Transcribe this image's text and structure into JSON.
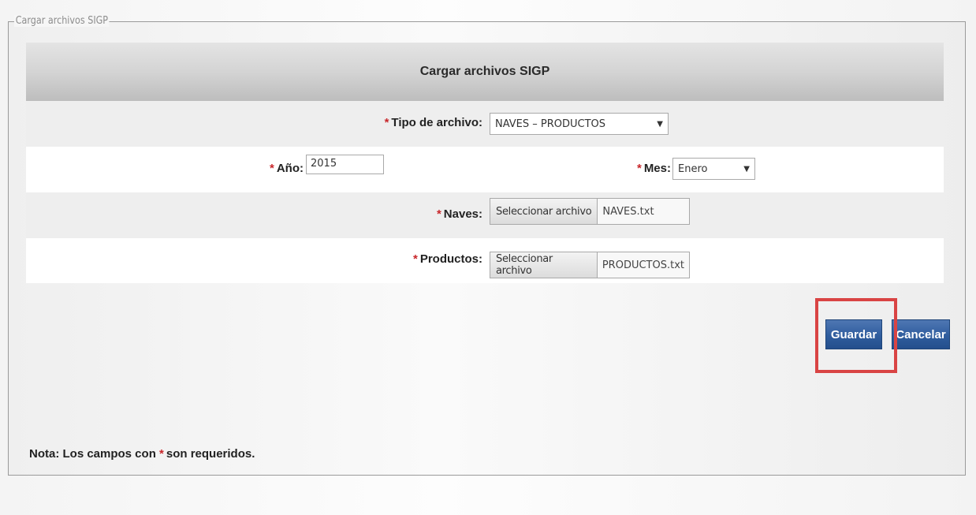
{
  "fieldset": {
    "legend": "Cargar archivos SIGP"
  },
  "form": {
    "header": "Cargar archivos SIGP",
    "required_mark": "*",
    "tipo_archivo": {
      "label": "Tipo de archivo:",
      "value": "NAVES – PRODUCTOS"
    },
    "anio": {
      "label": "Año:",
      "value": "2015"
    },
    "mes": {
      "label": "Mes:",
      "value": "Enero"
    },
    "naves": {
      "label": "Naves:",
      "button": "Seleccionar archivo",
      "file": "NAVES.txt"
    },
    "productos": {
      "label": "Productos:",
      "button": "Seleccionar archivo",
      "file": "PRODUCTOS.txt"
    }
  },
  "actions": {
    "save": "Guardar",
    "cancel": "Cancelar"
  },
  "note": {
    "prefix": "Nota: Los campos con",
    "mark": "*",
    "suffix": "son requeridos."
  },
  "colors": {
    "required": "#c8262a",
    "button": "#2f5d9e",
    "highlight": "#d94444"
  },
  "icons": {
    "dropdown": "▼"
  }
}
